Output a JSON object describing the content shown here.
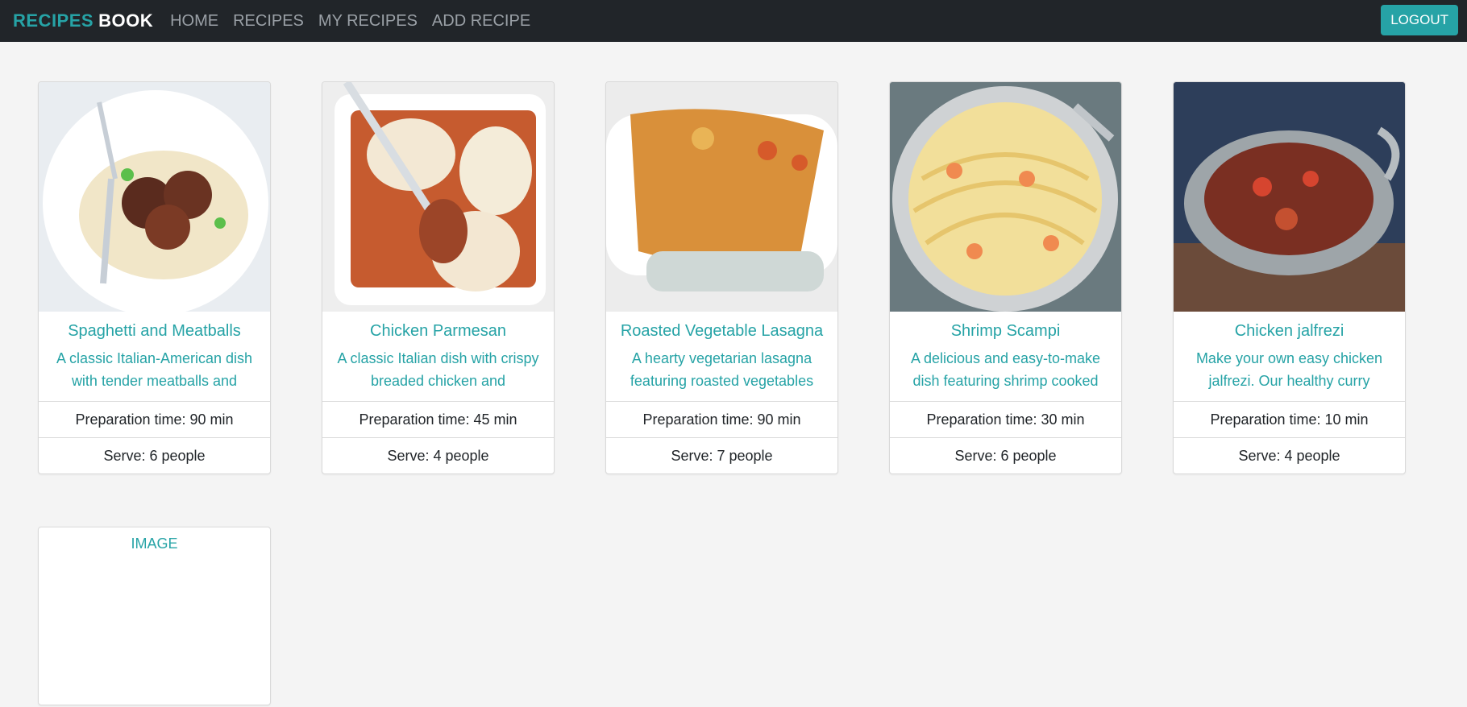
{
  "navbar": {
    "brand_part1": "RECIPES",
    "brand_part2": "BOOK",
    "links": [
      "HOME",
      "RECIPES",
      "MY RECIPES",
      "ADD RECIPE"
    ],
    "logout_label": "LOGOUT",
    "colors": {
      "accent": "#26a3a6",
      "bar": "#212529"
    }
  },
  "recipes": [
    {
      "title": "Spaghetti and Meatballs",
      "description": "A classic Italian-American dish with tender meatballs and",
      "prep": "Preparation time: 90 min",
      "serve": "Serve: 6 people"
    },
    {
      "title": "Chicken Parmesan",
      "description": "A classic Italian dish with crispy breaded chicken and",
      "prep": "Preparation time: 45 min",
      "serve": "Serve: 4 people"
    },
    {
      "title": "Roasted Vegetable Lasagna",
      "description": "A hearty vegetarian lasagna featuring roasted vegetables",
      "prep": "Preparation time: 90 min",
      "serve": "Serve: 7 people"
    },
    {
      "title": "Shrimp Scampi",
      "description": "A delicious and easy-to-make dish featuring shrimp cooked",
      "prep": "Preparation time: 30 min",
      "serve": "Serve: 6 people"
    },
    {
      "title": "Chicken jalfrezi",
      "description": "Make your own easy chicken jalfrezi. Our healthy curry",
      "prep": "Preparation time: 10 min",
      "serve": "Serve: 4 people"
    }
  ],
  "placeholder_card": {
    "image_alt_text": "IMAGE"
  }
}
